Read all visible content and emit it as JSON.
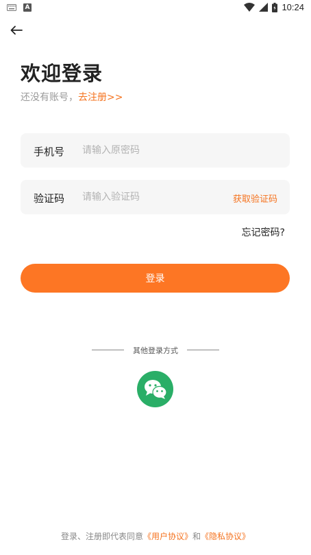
{
  "status_bar": {
    "a_badge": "A",
    "time": "10:24",
    "icons": [
      "keyboard-icon",
      "a-notification-icon",
      "wifi-icon",
      "signal-icon",
      "battery-icon"
    ]
  },
  "page": {
    "title": "欢迎登录",
    "subtitle_prefix": "还没有账号，",
    "register_link": "去注册>>"
  },
  "form": {
    "phone_label": "手机号",
    "phone_placeholder": "请输入原密码",
    "code_label": "验证码",
    "code_placeholder": "请输入验证码",
    "get_code": "获取验证码",
    "forgot_password": "忘记密码?",
    "login_button": "登录"
  },
  "other_login": {
    "label": "其他登录方式",
    "wechat_icon": "wechat-icon"
  },
  "agreement": {
    "prefix": "登录、注册即代表同意",
    "user_agreement": "《用户协议》",
    "and": "和",
    "privacy_policy": "《隐私协议》"
  },
  "colors": {
    "accent": "#fd7624",
    "link": "#f5731f",
    "wechat": "#2aae67",
    "field_bg": "#f6f6f6"
  }
}
